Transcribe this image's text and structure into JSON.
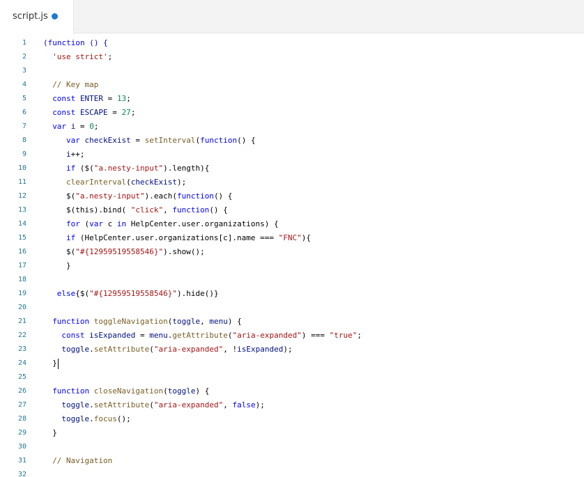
{
  "tab": {
    "title": "script.js",
    "modified_indicator": "unsaved-changes-dot"
  },
  "editor": {
    "lines": [
      {
        "n": "1",
        "indent": 0,
        "tokens": [
          {
            "t": "(function () {",
            "c": "kw"
          }
        ]
      },
      {
        "n": "2",
        "indent": 2,
        "tokens": [
          {
            "t": "'use strict'",
            "c": "str"
          },
          {
            "t": ";",
            "c": ""
          }
        ]
      },
      {
        "n": "3",
        "indent": 0,
        "tokens": []
      },
      {
        "n": "4",
        "indent": 2,
        "tokens": [
          {
            "t": "// Key map",
            "c": "com"
          }
        ]
      },
      {
        "n": "5",
        "indent": 2,
        "tokens": [
          {
            "t": "const ",
            "c": "kw"
          },
          {
            "t": "ENTER",
            "c": "var"
          },
          {
            "t": " = ",
            "c": ""
          },
          {
            "t": "13",
            "c": "num"
          },
          {
            "t": ";",
            "c": ""
          }
        ]
      },
      {
        "n": "6",
        "indent": 2,
        "tokens": [
          {
            "t": "const ",
            "c": "kw"
          },
          {
            "t": "ESCAPE",
            "c": "var"
          },
          {
            "t": " = ",
            "c": ""
          },
          {
            "t": "27",
            "c": "num"
          },
          {
            "t": ";",
            "c": ""
          }
        ]
      },
      {
        "n": "7",
        "indent": 2,
        "tokens": [
          {
            "t": "var ",
            "c": "kw"
          },
          {
            "t": "i",
            "c": "var"
          },
          {
            "t": " = ",
            "c": ""
          },
          {
            "t": "0",
            "c": "num"
          },
          {
            "t": ";",
            "c": ""
          }
        ]
      },
      {
        "n": "8",
        "indent": 5,
        "tokens": [
          {
            "t": "var ",
            "c": "kw"
          },
          {
            "t": "checkExist",
            "c": "var"
          },
          {
            "t": " = ",
            "c": ""
          },
          {
            "t": "setInterval",
            "c": "fn"
          },
          {
            "t": "(",
            "c": ""
          },
          {
            "t": "function",
            "c": "kw"
          },
          {
            "t": "() {",
            "c": ""
          }
        ]
      },
      {
        "n": "9",
        "indent": 5,
        "tokens": [
          {
            "t": "i",
            "c": "var"
          },
          {
            "t": "++;",
            "c": ""
          }
        ]
      },
      {
        "n": "10",
        "indent": 5,
        "tokens": [
          {
            "t": "if",
            "c": "kw"
          },
          {
            "t": " ($(",
            "c": ""
          },
          {
            "t": "\"a.nesty-input\"",
            "c": "str"
          },
          {
            "t": ").length){",
            "c": ""
          }
        ]
      },
      {
        "n": "11",
        "indent": 5,
        "tokens": [
          {
            "t": "clearInterval",
            "c": "fn"
          },
          {
            "t": "(",
            "c": ""
          },
          {
            "t": "checkExist",
            "c": "var"
          },
          {
            "t": ");",
            "c": ""
          }
        ]
      },
      {
        "n": "12",
        "indent": 5,
        "tokens": [
          {
            "t": "$(",
            "c": ""
          },
          {
            "t": "\"a.nesty-input\"",
            "c": "str"
          },
          {
            "t": ").each(",
            "c": ""
          },
          {
            "t": "function",
            "c": "kw"
          },
          {
            "t": "() {",
            "c": ""
          }
        ]
      },
      {
        "n": "13",
        "indent": 5,
        "tokens": [
          {
            "t": "$(this).bind( ",
            "c": ""
          },
          {
            "t": "\"click\"",
            "c": "str"
          },
          {
            "t": ", ",
            "c": ""
          },
          {
            "t": "function",
            "c": "kw"
          },
          {
            "t": "() {",
            "c": ""
          }
        ]
      },
      {
        "n": "14",
        "indent": 5,
        "tokens": [
          {
            "t": "for",
            "c": "kw"
          },
          {
            "t": " (",
            "c": ""
          },
          {
            "t": "var",
            "c": "kw"
          },
          {
            "t": " c ",
            "c": ""
          },
          {
            "t": "in",
            "c": "kw"
          },
          {
            "t": " HelpCenter.user.organizations) {",
            "c": ""
          }
        ]
      },
      {
        "n": "15",
        "indent": 5,
        "tokens": [
          {
            "t": "if",
            "c": "kw"
          },
          {
            "t": " (HelpCenter.user.organizations[c].name === ",
            "c": ""
          },
          {
            "t": "\"FNC\"",
            "c": "str"
          },
          {
            "t": "){",
            "c": ""
          }
        ]
      },
      {
        "n": "16",
        "indent": 5,
        "tokens": [
          {
            "t": "$(",
            "c": ""
          },
          {
            "t": "\"#{12959519558546}\"",
            "c": "str"
          },
          {
            "t": ").show();",
            "c": ""
          }
        ]
      },
      {
        "n": "17",
        "indent": 5,
        "tokens": [
          {
            "t": "}",
            "c": ""
          }
        ]
      },
      {
        "n": "18",
        "indent": 0,
        "tokens": []
      },
      {
        "n": "19",
        "indent": 3,
        "tokens": [
          {
            "t": "else",
            "c": "kw"
          },
          {
            "t": "{$(",
            "c": ""
          },
          {
            "t": "\"#{12959519558546}\"",
            "c": "str"
          },
          {
            "t": ").hide()}",
            "c": ""
          }
        ]
      },
      {
        "n": "20",
        "indent": 0,
        "tokens": []
      },
      {
        "n": "21",
        "indent": 2,
        "tokens": [
          {
            "t": "function ",
            "c": "kw"
          },
          {
            "t": "toggleNavigation",
            "c": "fn"
          },
          {
            "t": "(",
            "c": ""
          },
          {
            "t": "toggle",
            "c": "var"
          },
          {
            "t": ", ",
            "c": ""
          },
          {
            "t": "menu",
            "c": "var"
          },
          {
            "t": ") {",
            "c": ""
          }
        ]
      },
      {
        "n": "22",
        "indent": 4,
        "tokens": [
          {
            "t": "const ",
            "c": "kw"
          },
          {
            "t": "isExpanded",
            "c": "var"
          },
          {
            "t": " = ",
            "c": ""
          },
          {
            "t": "menu",
            "c": "var"
          },
          {
            "t": ".",
            "c": ""
          },
          {
            "t": "getAttribute",
            "c": "fn"
          },
          {
            "t": "(",
            "c": ""
          },
          {
            "t": "\"aria-expanded\"",
            "c": "str"
          },
          {
            "t": ") === ",
            "c": ""
          },
          {
            "t": "\"true\"",
            "c": "str"
          },
          {
            "t": ";",
            "c": ""
          }
        ]
      },
      {
        "n": "23",
        "indent": 4,
        "tokens": [
          {
            "t": "toggle",
            "c": "var"
          },
          {
            "t": ".",
            "c": ""
          },
          {
            "t": "setAttribute",
            "c": "fn"
          },
          {
            "t": "(",
            "c": ""
          },
          {
            "t": "\"aria-expanded\"",
            "c": "str"
          },
          {
            "t": ", !",
            "c": ""
          },
          {
            "t": "isExpanded",
            "c": "var"
          },
          {
            "t": ");",
            "c": ""
          }
        ]
      },
      {
        "n": "24",
        "indent": 2,
        "tokens": [
          {
            "t": "}",
            "c": ""
          }
        ],
        "cursor": true
      },
      {
        "n": "25",
        "indent": 0,
        "tokens": []
      },
      {
        "n": "26",
        "indent": 2,
        "tokens": [
          {
            "t": "function ",
            "c": "kw"
          },
          {
            "t": "closeNavigation",
            "c": "fn"
          },
          {
            "t": "(",
            "c": ""
          },
          {
            "t": "toggle",
            "c": "var"
          },
          {
            "t": ") {",
            "c": ""
          }
        ]
      },
      {
        "n": "27",
        "indent": 4,
        "tokens": [
          {
            "t": "toggle",
            "c": "var"
          },
          {
            "t": ".",
            "c": ""
          },
          {
            "t": "setAttribute",
            "c": "fn"
          },
          {
            "t": "(",
            "c": ""
          },
          {
            "t": "\"aria-expanded\"",
            "c": "str"
          },
          {
            "t": ", ",
            "c": ""
          },
          {
            "t": "false",
            "c": "kw"
          },
          {
            "t": ");",
            "c": ""
          }
        ]
      },
      {
        "n": "28",
        "indent": 4,
        "tokens": [
          {
            "t": "toggle",
            "c": "var"
          },
          {
            "t": ".",
            "c": ""
          },
          {
            "t": "focus",
            "c": "fn"
          },
          {
            "t": "();",
            "c": ""
          }
        ]
      },
      {
        "n": "29",
        "indent": 2,
        "tokens": [
          {
            "t": "}",
            "c": ""
          }
        ]
      },
      {
        "n": "30",
        "indent": 0,
        "tokens": []
      },
      {
        "n": "31",
        "indent": 2,
        "tokens": [
          {
            "t": "// Navigation",
            "c": "com"
          }
        ]
      },
      {
        "n": "32",
        "indent": 0,
        "tokens": []
      }
    ]
  },
  "colors": {
    "keyword": "#0000ff",
    "string": "#a31515",
    "number": "#098658",
    "comment": "#795e26",
    "variable": "#001080",
    "function": "#795e26",
    "line_number": "#237893",
    "modified_dot": "#1f78d1"
  }
}
